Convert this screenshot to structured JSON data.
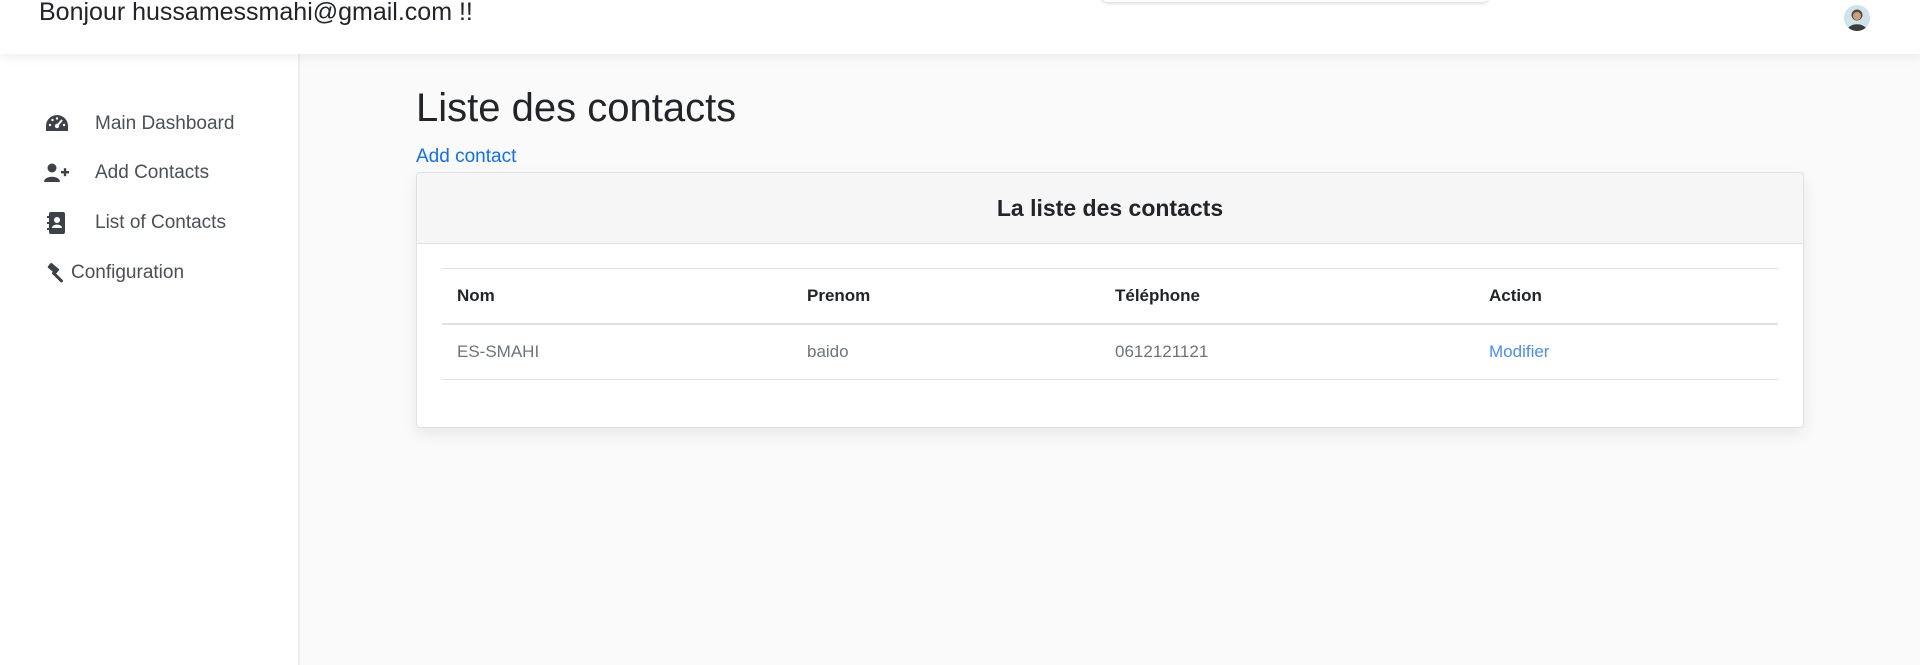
{
  "header": {
    "greeting": "Bonjour hussamessmahi@gmail.com !!",
    "avatar_icon": "user-avatar-icon"
  },
  "sidebar": {
    "items": [
      {
        "label": "Main Dashboard",
        "icon": "dashboard-gauge-icon"
      },
      {
        "label": "Add Contacts",
        "icon": "user-plus-icon"
      },
      {
        "label": "List of Contacts",
        "icon": "address-book-icon"
      },
      {
        "label": "Configuration",
        "icon": "hammer-icon"
      }
    ]
  },
  "main": {
    "title": "Liste des contacts",
    "add_link": "Add contact",
    "card": {
      "title": "La liste des contacts",
      "columns": [
        "Nom",
        "Prenom",
        "Téléphone",
        "Action"
      ],
      "rows": [
        {
          "nom": "ES-SMAHI",
          "prenom": "baido",
          "telephone": "0612121121",
          "action": "Modifier"
        }
      ]
    }
  },
  "colors": {
    "link": "#0d6efd",
    "action_link": "#4a8df8",
    "page_bg": "#fafafa",
    "card_header_bg": "#f6f6f6"
  }
}
